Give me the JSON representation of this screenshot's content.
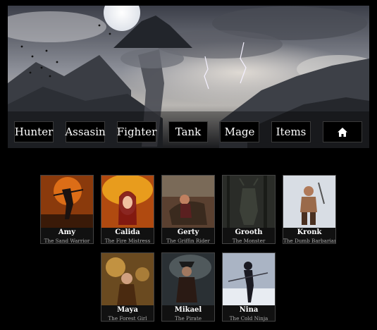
{
  "nav": {
    "items": [
      {
        "label": "Hunter"
      },
      {
        "label": "Assasin"
      },
      {
        "label": "Fighter"
      },
      {
        "label": "Tank"
      },
      {
        "label": "Mage"
      },
      {
        "label": "Items"
      }
    ],
    "home_icon": "home-icon"
  },
  "characters": [
    {
      "name": "Amy",
      "title": "The Sand Warrior"
    },
    {
      "name": "Calida",
      "title": "The Fire Mistress"
    },
    {
      "name": "Gerty",
      "title": "The Griffin Rider"
    },
    {
      "name": "Grooth",
      "title": "The Monster"
    },
    {
      "name": "Kronk",
      "title": "The Dumb Barbarian"
    },
    {
      "name": "Maya",
      "title": "The Forest Girl"
    },
    {
      "name": "Mikael",
      "title": "The Pirate"
    },
    {
      "name": "Nina",
      "title": "The Cold Ninja"
    }
  ]
}
